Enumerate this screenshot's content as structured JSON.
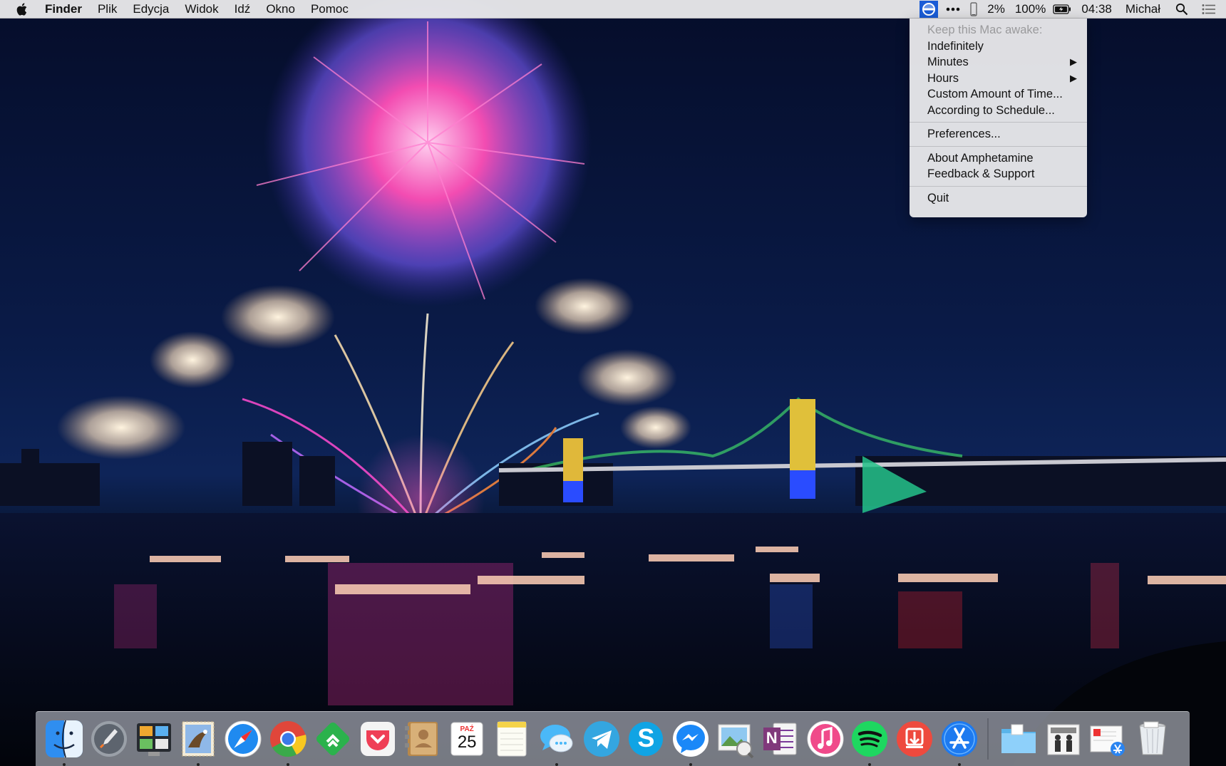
{
  "menubar": {
    "app_name": "Finder",
    "menus": [
      "Plik",
      "Edycja",
      "Widok",
      "Idź",
      "Okno",
      "Pomoc"
    ],
    "status": {
      "cpu_percent": "2%",
      "battery_percent": "100%",
      "time": "04:38",
      "user": "Michał"
    }
  },
  "amphetamine_menu": {
    "header": "Keep this Mac awake:",
    "items": {
      "indefinitely": "Indefinitely",
      "minutes": "Minutes",
      "hours": "Hours",
      "custom": "Custom Amount of Time...",
      "schedule": "According to Schedule...",
      "preferences": "Preferences...",
      "about": "About Amphetamine",
      "feedback": "Feedback & Support",
      "quit": "Quit"
    }
  },
  "dock": {
    "calendar_month": "PAŹ",
    "calendar_day": "25",
    "onenote_letter": "N",
    "skype_letter": "S",
    "items": [
      {
        "name": "Finder",
        "running": true
      },
      {
        "name": "Launchpad",
        "running": false
      },
      {
        "name": "Screenshot Tool",
        "running": false
      },
      {
        "name": "Mail",
        "running": true
      },
      {
        "name": "Safari",
        "running": false
      },
      {
        "name": "Chrome",
        "running": true
      },
      {
        "name": "Feedly",
        "running": false
      },
      {
        "name": "Pocket",
        "running": false
      },
      {
        "name": "Contacts",
        "running": false
      },
      {
        "name": "Calendar",
        "running": false
      },
      {
        "name": "Notes",
        "running": false
      },
      {
        "name": "Messages",
        "running": true
      },
      {
        "name": "Telegram",
        "running": false
      },
      {
        "name": "Skype",
        "running": false
      },
      {
        "name": "Messenger",
        "running": true
      },
      {
        "name": "Preview",
        "running": false
      },
      {
        "name": "OneNote",
        "running": false
      },
      {
        "name": "iTunes",
        "running": false
      },
      {
        "name": "Spotify",
        "running": true
      },
      {
        "name": "Transmit",
        "running": false
      },
      {
        "name": "App Store",
        "running": true
      },
      {
        "name": "Downloads Folder",
        "running": false
      },
      {
        "name": "Documents Stack",
        "running": false
      },
      {
        "name": "Installers Stack",
        "running": false
      },
      {
        "name": "Trash",
        "running": false
      }
    ]
  }
}
